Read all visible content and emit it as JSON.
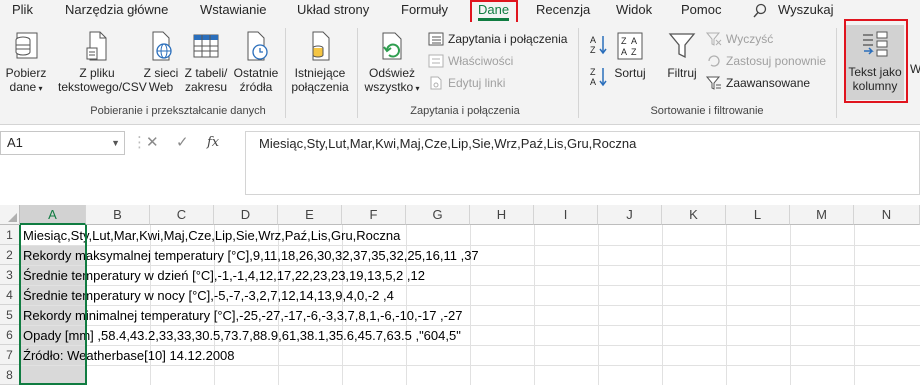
{
  "tabs": [
    "Plik",
    "Narzędzia główne",
    "Wstawianie",
    "Układ strony",
    "Formuły",
    "Dane",
    "Recenzja",
    "Widok",
    "Pomoc"
  ],
  "active_tab": "Dane",
  "tell_me": "Wyszukaj",
  "ribbon": {
    "get_data": {
      "line1": "Pobierz",
      "line2": "dane"
    },
    "from_text": {
      "line1": "Z pliku",
      "line2": "tekstowego/CSV"
    },
    "from_web": {
      "line1": "Z sieci",
      "line2": "Web"
    },
    "from_table": {
      "line1": "Z tabeli/",
      "line2": "zakresu"
    },
    "recent": {
      "line1": "Ostatnie",
      "line2": "źródła"
    },
    "existing": {
      "line1": "Istniejące",
      "line2": "połączenia"
    },
    "group1_label": "Pobieranie i przekształcanie danych",
    "refresh": {
      "line1": "Odśwież",
      "line2": "wszystko"
    },
    "queries": "Zapytania i połączenia",
    "properties": "Właściwości",
    "edit_links": "Edytuj linki",
    "group2_label": "Zapytania i połączenia",
    "sort": "Sortuj",
    "filter": "Filtruj",
    "clear": "Wyczyść",
    "reapply": "Zastosuj ponownie",
    "advanced": "Zaawansowane",
    "group3_label": "Sortowanie i filtrowanie",
    "text_to_columns": {
      "line1": "Tekst jako",
      "line2": "kolumny"
    },
    "truncated": "W"
  },
  "formula_bar": {
    "name_box": "A1",
    "content": "Miesiąc,Sty,Lut,Mar,Kwi,Maj,Cze,Lip,Sie,Wrz,Paź,Lis,Gru,Roczna"
  },
  "columns": [
    "A",
    "B",
    "C",
    "D",
    "E",
    "F",
    "G",
    "H",
    "I",
    "J",
    "K",
    "L",
    "M",
    "N"
  ],
  "rows": [
    "1",
    "2",
    "3",
    "4",
    "5",
    "6",
    "7",
    "8"
  ],
  "cells": [
    "Miesiąc,Sty,Lut,Mar,Kwi,Maj,Cze,Lip,Sie,Wrz,Paź,Lis,Gru,Roczna",
    "Rekordy maksymalnej temperatury [°C],9,11,18,26,30,32,37,35,32,25,16,11 ,37",
    "Średnie temperatury w dzień [°C],-1,-1,4,12,17,22,23,23,19,13,5,2 ,12",
    "Średnie temperatury w nocy [°C],-5,-7,-3,2,7,12,14,13,9,4,0,-2 ,4",
    "Rekordy minimalnej temperatury [°C],-25,-27,-17,-6,-3,3,7,8,1,-6,-10,-17 ,-27",
    "Opady [mm] ,58.4,43.2,33,33,30.5,73.7,88.9,61,38.1,35.6,45.7,63.5 ,\"604,5\"",
    "Źródło: Weatherbase[10] 14.12.2008",
    ""
  ],
  "colors": {
    "accent": "#107c41",
    "highlight": "#e0141e"
  }
}
